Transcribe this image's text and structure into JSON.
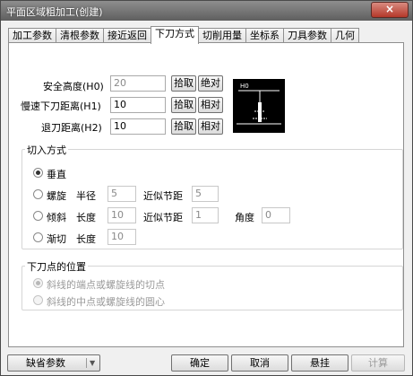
{
  "window": {
    "title": "平面区域粗加工(创建)",
    "close_label": "×"
  },
  "tabs": [
    "加工参数",
    "清根参数",
    "接近返回",
    "下刀方式",
    "切削用量",
    "坐标系",
    "刀具参数",
    "几何"
  ],
  "heights": {
    "safe_label": "安全高度(H0)",
    "safe_value": "20",
    "slow_label": "慢速下刀距离(H1)",
    "slow_value": "10",
    "retract_label": "退刀距离(H2)",
    "retract_value": "10",
    "pick_label": "拾取",
    "absolute_label": "绝对",
    "relative_label": "相对"
  },
  "preview": {
    "label": "H0"
  },
  "cut_in": {
    "title": "切入方式",
    "vertical_label": "垂直",
    "spiral_label": "螺旋",
    "radius_label": "半径",
    "spiral_radius": "5",
    "approx_pitch_label": "近似节距",
    "spiral_pitch": "5",
    "ramp_label": "倾斜",
    "length_label": "长度",
    "ramp_length": "10",
    "ramp_pitch": "1",
    "angle_label": "角度",
    "ramp_angle": "0",
    "tangent_label": "渐切",
    "tangent_length": "10"
  },
  "entry_point": {
    "title": "下刀点的位置",
    "option1": "斜线的端点或螺旋线的切点",
    "option2": "斜线的中点或螺旋线的圆心"
  },
  "footer": {
    "defaults_label": "缺省参数",
    "ok_label": "确定",
    "cancel_label": "取消",
    "suspend_label": "悬挂",
    "calc_label": "计算"
  }
}
